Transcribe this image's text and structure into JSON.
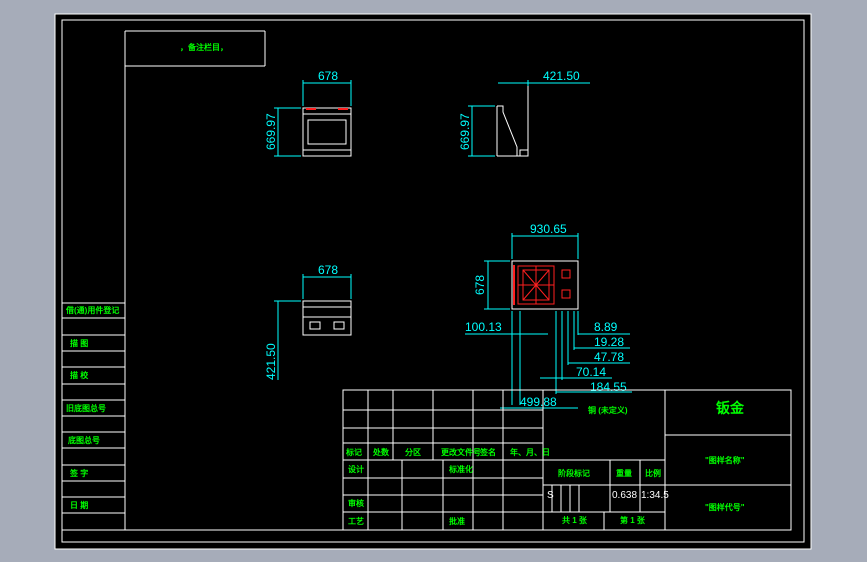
{
  "note_box": {
    "text": "，备注栏目，"
  },
  "views": {
    "front": {
      "width": "678",
      "height": "669.97"
    },
    "side": {
      "depth": "421.50",
      "height": "669.97"
    },
    "top": {
      "width": "678",
      "depth": "421.50"
    },
    "detail": {
      "width": "930.65",
      "height": "678",
      "offset_left": "100.13",
      "offsets": [
        "8.89",
        "19.28",
        "47.78",
        "70.14",
        "184.55",
        "499.88"
      ]
    }
  },
  "left_column": [
    "借(通)用件登记",
    "描  图",
    "描  校",
    "旧底图总号",
    "底图总号",
    "签  字",
    "日  期"
  ],
  "title_block": {
    "header_labels": [
      "标记",
      "处数",
      "分区",
      "更改文件号",
      "签名",
      "年、月、日"
    ],
    "row_labels": {
      "design": "设计",
      "standardize": "标准化",
      "review": "审核",
      "process": "工艺",
      "approve": "批准"
    },
    "material": "铜 (未定义)",
    "stage_label": "阶段标记",
    "weight_label": "重量",
    "scale_label": "比例",
    "stage_value": "S",
    "weight_value": "0.638",
    "scale_value": "1:34.5",
    "sheet_total": "共 1 张",
    "sheet_no": "第 1 张",
    "company": "钣金",
    "drawing_name": "\"图样名称\"",
    "drawing_code": "\"图样代号\""
  }
}
